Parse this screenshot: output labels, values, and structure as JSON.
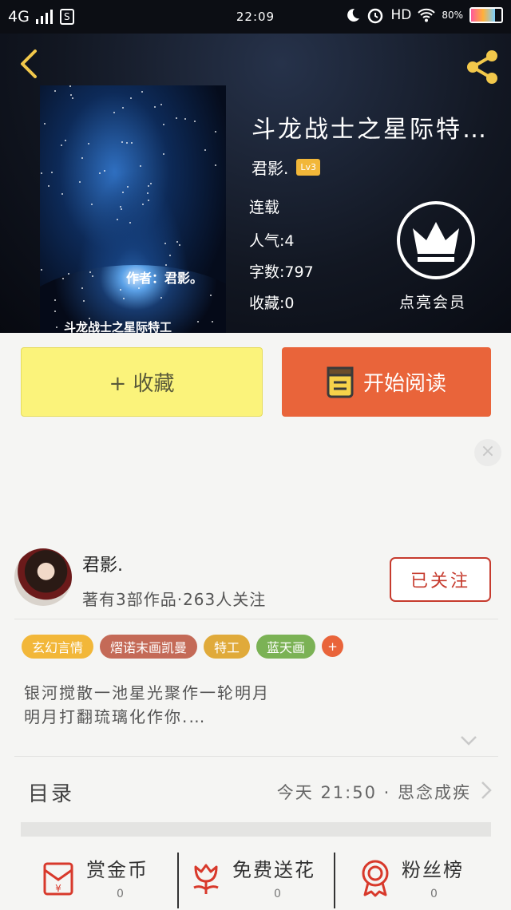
{
  "status_bar": {
    "network": "4G",
    "time": "22:09",
    "hd": "HD",
    "battery": "80%",
    "battery_level": 0.8
  },
  "book": {
    "title": "斗龙战士之星际特…",
    "author": "君影.",
    "level_badge": "Lv3",
    "status": "连载",
    "popularity": "人气:4",
    "word_count": "字数:797",
    "favorites": "收藏:0",
    "cover": {
      "author_text": "作者：君影。",
      "title_text": "斗龙战士之星际特工"
    }
  },
  "vip": {
    "label": "点亮会员"
  },
  "actions": {
    "collect_label": "+ 收藏",
    "read_label": "开始阅读"
  },
  "author_panel": {
    "name": "君影.",
    "stats": "著有3部作品·263人关注",
    "follow_label": "已关注"
  },
  "tags": [
    {
      "label": "玄幻言情",
      "color": "#f2b739"
    },
    {
      "label": "熠诺末画凯曼",
      "color": "#c46a57"
    },
    {
      "label": "特工",
      "color": "#e0aa3a"
    },
    {
      "label": "蓝天画",
      "color": "#7bb255"
    }
  ],
  "tag_more": "+",
  "summary": {
    "line1": "银河搅散一池星光聚作一轮明月",
    "line2": "明月打翻琉璃化作你.…"
  },
  "catalog": {
    "label": "目录",
    "latest": "今天 21:50 · 思念成疾"
  },
  "bottom_bar": [
    {
      "label": "赏金币",
      "count": "0",
      "icon": "red-envelope-icon"
    },
    {
      "label": "免费送花",
      "count": "0",
      "icon": "flower-icon"
    },
    {
      "label": "粉丝榜",
      "count": "0",
      "icon": "medal-icon"
    }
  ],
  "colors": {
    "accent_orange": "#e9643a",
    "collect_yellow": "#fbf37b",
    "follow_red": "#c63b2e",
    "crown_badge": "#f2b739",
    "icon_red": "#d8392b"
  }
}
